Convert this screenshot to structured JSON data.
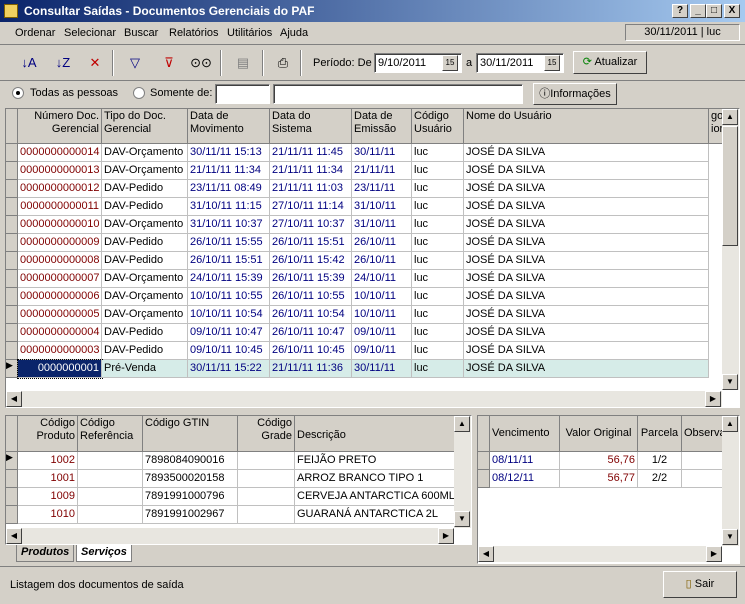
{
  "window": {
    "title": "Consultar Saídas - Documentos Gerenciais do PAF",
    "help_btn": "?",
    "min_btn": "_",
    "max_btn": "□",
    "close_btn": "X"
  },
  "menu": [
    "Ordenar",
    "Selecionar",
    "Buscar",
    "Relatórios",
    "Utilitários",
    "Ajuda"
  ],
  "session": "30/11/2011 | luc",
  "period": {
    "label": "Período: De",
    "from": "9/10/2011",
    "to_label": "a",
    "to": "30/11/2011",
    "update_label": "Atualizar"
  },
  "filter": {
    "all_label": "Todas as pessoas",
    "only_label": "Somente de:",
    "selected": "all",
    "info_label": "Informações"
  },
  "main_grid": {
    "headers": [
      "Número Doc. Gerencial",
      "Tipo do Doc. Gerencial",
      "Data de Movimento",
      "Data do Sistema",
      "Data de Emissão",
      "Código Usuário",
      "Nome do Usuário",
      "go ior"
    ],
    "selected_index": 12,
    "rows": [
      [
        "0000000000014",
        "DAV-Orçamento",
        "30/11/11 15:13",
        "21/11/11 11:45",
        "30/11/11",
        "luc",
        "JOSÉ DA SILVA"
      ],
      [
        "0000000000013",
        "DAV-Orçamento",
        "21/11/11 11:34",
        "21/11/11 11:34",
        "21/11/11",
        "luc",
        "JOSÉ DA SILVA"
      ],
      [
        "0000000000012",
        "DAV-Pedido",
        "23/11/11 08:49",
        "21/11/11 11:03",
        "23/11/11",
        "luc",
        "JOSÉ DA SILVA"
      ],
      [
        "0000000000011",
        "DAV-Pedido",
        "31/10/11 11:15",
        "27/10/11 11:14",
        "31/10/11",
        "luc",
        "JOSÉ DA SILVA"
      ],
      [
        "0000000000010",
        "DAV-Orçamento",
        "31/10/11 10:37",
        "27/10/11 10:37",
        "31/10/11",
        "luc",
        "JOSÉ DA SILVA"
      ],
      [
        "0000000000009",
        "DAV-Pedido",
        "26/10/11 15:55",
        "26/10/11 15:51",
        "26/10/11",
        "luc",
        "JOSÉ DA SILVA"
      ],
      [
        "0000000000008",
        "DAV-Pedido",
        "26/10/11 15:51",
        "26/10/11 15:42",
        "26/10/11",
        "luc",
        "JOSÉ DA SILVA"
      ],
      [
        "0000000000007",
        "DAV-Orçamento",
        "24/10/11 15:39",
        "26/10/11 15:39",
        "24/10/11",
        "luc",
        "JOSÉ DA SILVA"
      ],
      [
        "0000000000006",
        "DAV-Orçamento",
        "10/10/11 10:55",
        "26/10/11 10:55",
        "10/10/11",
        "luc",
        "JOSÉ DA SILVA"
      ],
      [
        "0000000000005",
        "DAV-Orçamento",
        "10/10/11 10:54",
        "26/10/11 10:54",
        "10/10/11",
        "luc",
        "JOSÉ DA SILVA"
      ],
      [
        "0000000000004",
        "DAV-Pedido",
        "09/10/11 10:47",
        "26/10/11 10:47",
        "09/10/11",
        "luc",
        "JOSÉ DA SILVA"
      ],
      [
        "0000000000003",
        "DAV-Pedido",
        "09/10/11 10:45",
        "26/10/11 10:45",
        "09/10/11",
        "luc",
        "JOSÉ DA SILVA"
      ],
      [
        "0000000001",
        "Pré-Venda",
        "30/11/11 15:22",
        "21/11/11 11:36",
        "30/11/11",
        "luc",
        "JOSÉ DA SILVA"
      ]
    ]
  },
  "items_grid": {
    "headers": [
      "Código Produto",
      "Código Referência",
      "Código GTIN",
      "Código Grade",
      "Descrição"
    ],
    "rows": [
      [
        "1002",
        "",
        "7898084090016",
        "",
        "FEIJÃO PRETO"
      ],
      [
        "1001",
        "",
        "7893500020158",
        "",
        "ARROZ BRANCO TIPO 1"
      ],
      [
        "1009",
        "",
        "7891991000796",
        "",
        "CERVEJA ANTARCTICA 600ML"
      ],
      [
        "1010",
        "",
        "7891991002967",
        "",
        "GUARANÁ ANTARCTICA 2L"
      ]
    ],
    "tabs": [
      "Produtos",
      "Serviços"
    ]
  },
  "payments_grid": {
    "headers": [
      "Vencimento",
      "Valor Original",
      "Parcela",
      "Observa"
    ],
    "rows": [
      [
        "08/11/11",
        "56,76",
        "1/2",
        ""
      ],
      [
        "08/12/11",
        "56,77",
        "2/2",
        ""
      ]
    ]
  },
  "status": {
    "text": "Listagem dos documentos de saída",
    "exit_label": "Sair"
  }
}
